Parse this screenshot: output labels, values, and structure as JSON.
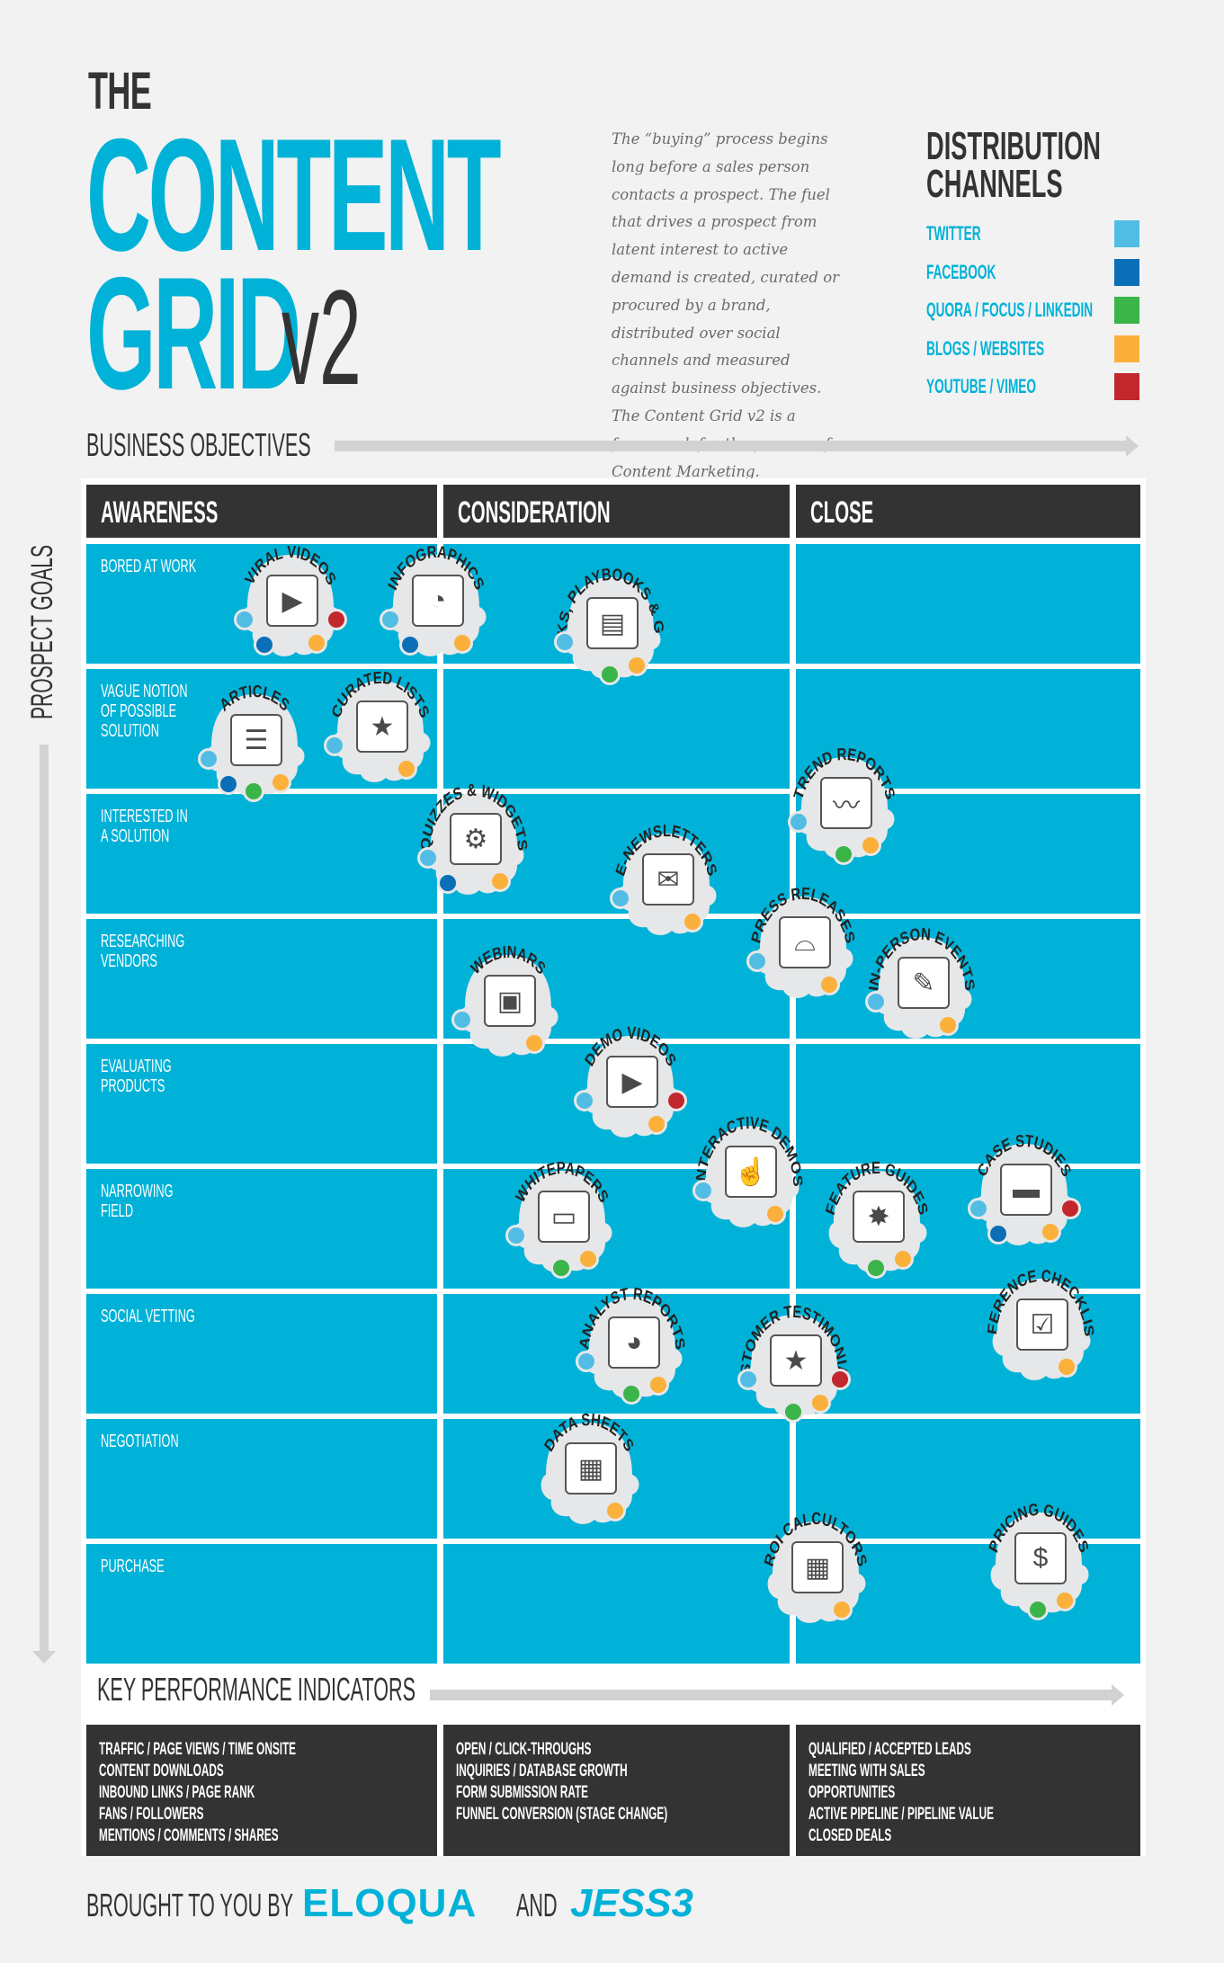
{
  "header": {
    "the": "THE",
    "title_line1": "CONTENT",
    "title_line2": "GRID",
    "version": "v2",
    "intro": "The “buying” process begins long before a sales person contacts a prospect. The fuel that drives a prospect from latent interest to active demand is created, curated or procured by a brand, distributed over social channels and measured against business objectives. The Content Grid v2 is a framework for the process of Content Marketing."
  },
  "distribution": {
    "title_line1": "DISTRIBUTION",
    "title_line2": "CHANNELS",
    "channels": [
      {
        "key": "twitter",
        "label": "TWITTER",
        "color": "#52bde4"
      },
      {
        "key": "facebook",
        "label": "FACEBOOK",
        "color": "#0a6fb7"
      },
      {
        "key": "quora",
        "label": "QUORA / FOCUS / LINKEDIN",
        "color": "#3bb44a"
      },
      {
        "key": "blogs",
        "label": "BLOGS / WEBSITES",
        "color": "#fbb03b"
      },
      {
        "key": "youtube",
        "label": "YOUTUBE / VIMEO",
        "color": "#c1272d"
      }
    ]
  },
  "axes": {
    "business_objectives": "BUSINESS OBJECTIVES",
    "prospect_goals": "PROSPECT GOALS",
    "kpi_title": "KEY PERFORMANCE INDICATORS"
  },
  "columns": [
    "AWARENESS",
    "CONSIDERATION",
    "CLOSE"
  ],
  "rows": [
    "BORED AT WORK",
    "VAGUE NOTION\nOF POSSIBLE\nSOLUTION",
    "INTERESTED IN\nA SOLUTION",
    "RESEARCHING\nVENDORS",
    "EVALUATING\nPRODUCTS",
    "NARROWING\nFIELD",
    "SOCIAL VETTING",
    "NEGOTIATION",
    "PURCHASE"
  ],
  "content_types": [
    {
      "name": "VIRAL VIDEOS",
      "icon": "tv-play-icon",
      "channels": [
        "twitter",
        "facebook",
        "blogs",
        "youtube"
      ]
    },
    {
      "name": "INFOGRAPHICS",
      "icon": "presentation-chart-icon",
      "channels": [
        "twitter",
        "facebook",
        "blogs"
      ]
    },
    {
      "name": "EBOOKS, PLAYBOOKS & GUIDES",
      "icon": "ereader-icon",
      "channels": [
        "twitter",
        "quora",
        "blogs"
      ]
    },
    {
      "name": "ARTICLES",
      "icon": "newspaper-icon",
      "channels": [
        "twitter",
        "facebook",
        "quora",
        "blogs"
      ]
    },
    {
      "name": "CURATED LISTS",
      "icon": "top-ten-booklet-icon",
      "channels": [
        "twitter",
        "blogs"
      ]
    },
    {
      "name": "TREND REPORTS",
      "icon": "trend-report-icon",
      "channels": [
        "twitter",
        "quora",
        "blogs"
      ]
    },
    {
      "name": "QUIZZES & WIDGETS",
      "icon": "gears-icon",
      "channels": [
        "twitter",
        "facebook",
        "blogs"
      ]
    },
    {
      "name": "E-NEWSLETTERS",
      "icon": "newsletter-cursor-icon",
      "channels": [
        "twitter",
        "blogs"
      ]
    },
    {
      "name": "PRESS RELEASES",
      "icon": "press-hat-icon",
      "channels": [
        "twitter",
        "blogs"
      ]
    },
    {
      "name": "WEBINARS",
      "icon": "webinar-screen-icon",
      "channels": [
        "twitter",
        "blogs"
      ]
    },
    {
      "name": "IN-PERSON EVENTS",
      "icon": "name-tag-icon",
      "channels": [
        "twitter",
        "blogs"
      ]
    },
    {
      "name": "DEMO VIDEOS",
      "icon": "step-video-icon",
      "channels": [
        "twitter",
        "blogs",
        "youtube"
      ]
    },
    {
      "name": "INTERACTIVE DEMOS",
      "icon": "demo-button-icon",
      "channels": [
        "twitter",
        "blogs"
      ]
    },
    {
      "name": "WHITEPAPERS",
      "icon": "clipped-paper-icon",
      "channels": [
        "twitter",
        "quora",
        "blogs"
      ]
    },
    {
      "name": "FEATURE GUIDES",
      "icon": "blueprint-icon",
      "channels": [
        "quora",
        "blogs"
      ]
    },
    {
      "name": "CASE STUDIES",
      "icon": "briefcase-icon",
      "channels": [
        "twitter",
        "facebook",
        "blogs",
        "youtube"
      ]
    },
    {
      "name": "ANALYST REPORTS",
      "icon": "pie-report-icon",
      "channels": [
        "twitter",
        "quora",
        "blogs"
      ]
    },
    {
      "name": "CUSTOMER TESTIMONIALS",
      "icon": "star-person-icon",
      "channels": [
        "twitter",
        "quora",
        "blogs",
        "youtube"
      ]
    },
    {
      "name": "REFERENCE CHECKLISTS",
      "icon": "checklist-icon",
      "channels": [
        "blogs"
      ]
    },
    {
      "name": "DATA SHEETS",
      "icon": "spreadsheet-icon",
      "channels": [
        "blogs"
      ]
    },
    {
      "name": "ROI CALCULTORS",
      "icon": "calculator-icon",
      "channels": [
        "blogs"
      ]
    },
    {
      "name": "PRICING GUIDES",
      "icon": "dollar-bill-icon",
      "channels": [
        "quora",
        "blogs"
      ]
    }
  ],
  "kpis": [
    [
      "TRAFFIC / PAGE VIEWS / TIME ONSITE",
      "CONTENT DOWNLOADS",
      "INBOUND LINKS / PAGE RANK",
      "FANS / FOLLOWERS",
      "MENTIONS / COMMENTS / SHARES"
    ],
    [
      "OPEN / CLICK-THROUGHS",
      "INQUIRIES / DATABASE GROWTH",
      "FORM SUBMISSION RATE",
      "FUNNEL CONVERSION (STAGE CHANGE)"
    ],
    [
      "QUALIFIED / ACCEPTED LEADS",
      "MEETING WITH SALES",
      "OPPORTUNITIES",
      "ACTIVE PIPELINE / PIPELINE VALUE",
      "CLOSED DEALS"
    ]
  ],
  "footer": {
    "brought_by": "BROUGHT TO YOU BY",
    "brand1": "ELOQUA",
    "and": "AND",
    "brand2": "JESS3"
  },
  "colors": {
    "accent": "#00b2d8",
    "dark": "#333333",
    "bubble": "#e6e7e8"
  }
}
